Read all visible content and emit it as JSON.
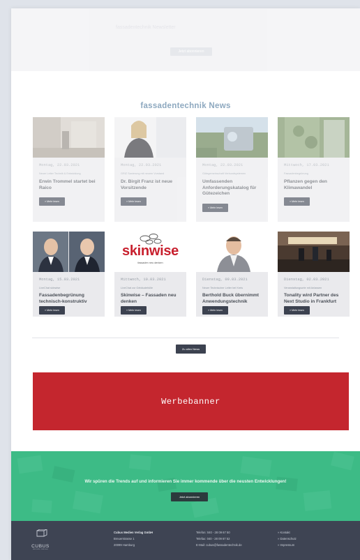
{
  "hero": {
    "title": "fassadentechnik Newsletter",
    "button_label": "Jetzt abonnieren"
  },
  "news_section": {
    "title": "fassadentechnik News",
    "read_more_label": "» Mehr lesen",
    "all_news_label": "Zu allen News",
    "cards": [
      {
        "date": "Montag, 22.03.2021",
        "kicker": "Neuer Leiter Technik & Entwicklung",
        "headline": "Erwin Trommel startet bei Raico"
      },
      {
        "date": "Montag, 22.03.2021",
        "kicker": "GRIZ Sanierung mit neuem Vorstand",
        "headline": "Dr. Birgit Franz ist neue Vorsitzende"
      },
      {
        "date": "Montag, 22.03.2021",
        "kicker": "Gütegemeinschaft Verbundsystemen",
        "headline": "Umfassenden Anforderungskatalog für Gütezeichen"
      },
      {
        "date": "Mittwoch, 17.03.2021",
        "kicker": "Fassadenbegrünung",
        "headline": "Pflanzen gegen den Klimawandel"
      },
      {
        "date": "Montag, 15.03.2021",
        "kicker": "LiveChat skinwise",
        "headline": "Fassadenbegrünung technisch-konstruktiv"
      },
      {
        "date": "Mittwoch, 10.03.2021",
        "kicker": "LiveChat zur Gebäudehülle",
        "headline": "Skinwise – Fassaden neu denken"
      },
      {
        "date": "Dienstag, 09.03.2021",
        "kicker": "Neuer Technischer Leiter bei Kreis",
        "headline": "Berthold Buck übernimmt Anwendungstechnik"
      },
      {
        "date": "Dienstag, 02.03.2021",
        "kicker": "Veranstaltungsorte mit Anlassen",
        "headline": "Tonality wird Partner des Next Studio in Frankfurt"
      }
    ],
    "skinwise_logo": "skinwise",
    "skinwise_tagline": "fassaden neu denken"
  },
  "banner": {
    "label": "Werbebanner",
    "color": "#c4262e"
  },
  "newsletter": {
    "text": "Wir spüren die Trends auf und informieren Sie immer kommende über die neusten Entwicklungen!",
    "button_label": "Jetzt abonnieren",
    "color": "#3dbb86"
  },
  "footer": {
    "logo_text": "CUBUS",
    "logo_subtext": "MEDIEN VERLAG",
    "company": "Cubus Medien Verlag GmbH",
    "street": "Breuerstrasse 1",
    "city": "20099 Hamburg",
    "phone": "Telefon: 040 - 28 09 67 50",
    "fax": "Telefax: 040 - 28 09 67 52",
    "email": "E-Mail: cubus@fassadentechnik.de",
    "links": [
      "» Kontakt",
      "» Datenschutz",
      "» Impressum"
    ],
    "color": "#3e4453"
  }
}
